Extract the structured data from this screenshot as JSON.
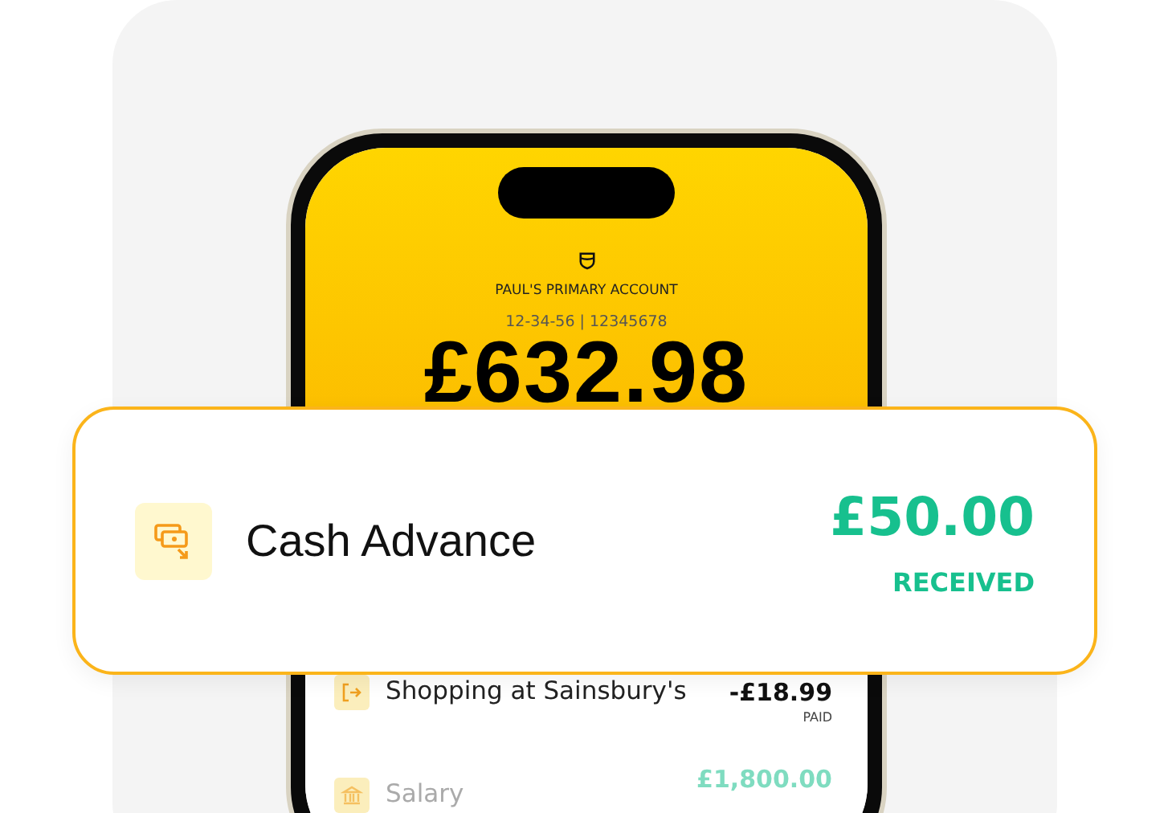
{
  "account": {
    "name": "PAUL'S PRIMARY ACCOUNT",
    "number": "12-34-56 | 12345678",
    "balance": "£632.98"
  },
  "notification": {
    "title": "Cash Advance",
    "amount": "£50.00",
    "status": "RECEIVED"
  },
  "transactions": [
    {
      "kind": "debit",
      "title": "Shopping at Sainsbury's",
      "amount": "-£18.99",
      "status": "PAID"
    },
    {
      "kind": "credit",
      "title": "Salary",
      "amount": "£1,800.00"
    }
  ]
}
